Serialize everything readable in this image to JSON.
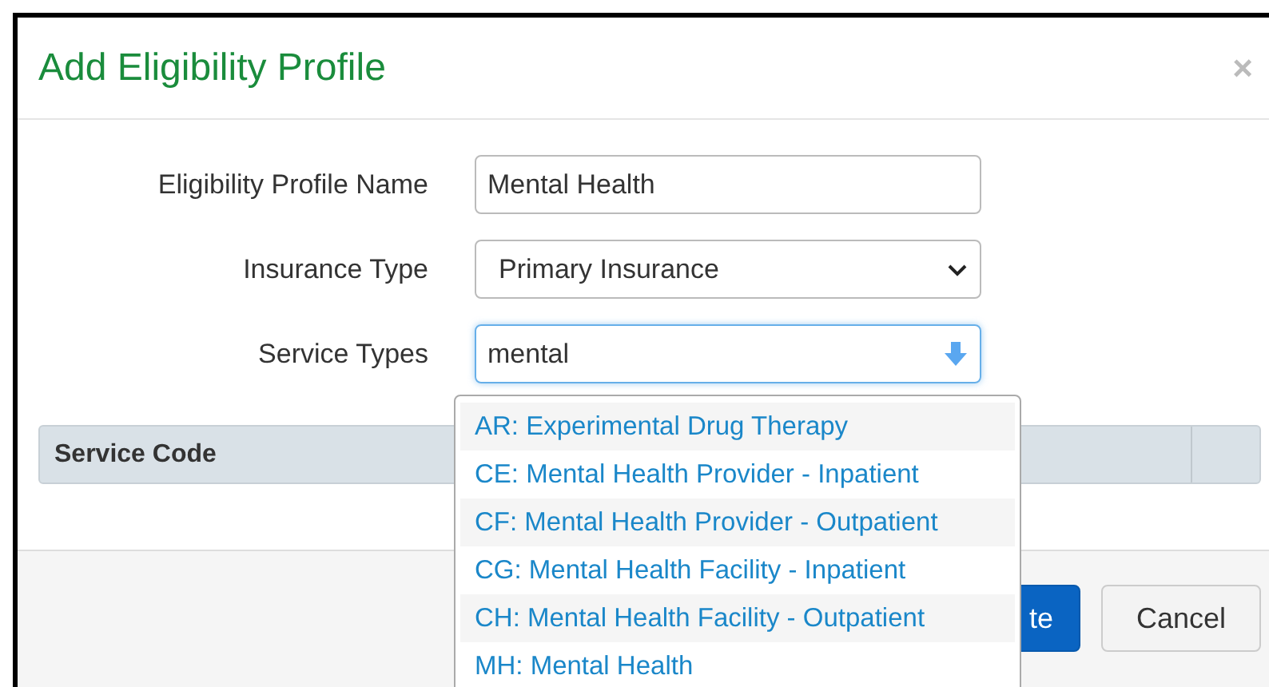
{
  "dialog": {
    "title": "Add Eligibility Profile",
    "close": "×"
  },
  "form": [
    {
      "label": "Eligibility Profile Name",
      "kind": "text",
      "value": "Mental Health",
      "focused": false
    },
    {
      "label": "Insurance Type",
      "kind": "select",
      "value": "Primary Insurance",
      "focused": false
    },
    {
      "label": "Service Types",
      "kind": "combo",
      "value": "mental",
      "focused": true
    }
  ],
  "table": {
    "columns": [
      "Service Code"
    ]
  },
  "dropdown": {
    "options": [
      "AR: Experimental Drug Therapy",
      "CE: Mental Health Provider - Inpatient",
      "CF: Mental Health Provider - Outpatient",
      "CG: Mental Health Facility - Inpatient",
      "CH: Mental Health Facility - Outpatient",
      "MH: Mental Health"
    ]
  },
  "footer": {
    "buttons": [
      {
        "label": "te",
        "kind": "primary"
      },
      {
        "label": "Cancel",
        "kind": "default"
      }
    ]
  }
}
